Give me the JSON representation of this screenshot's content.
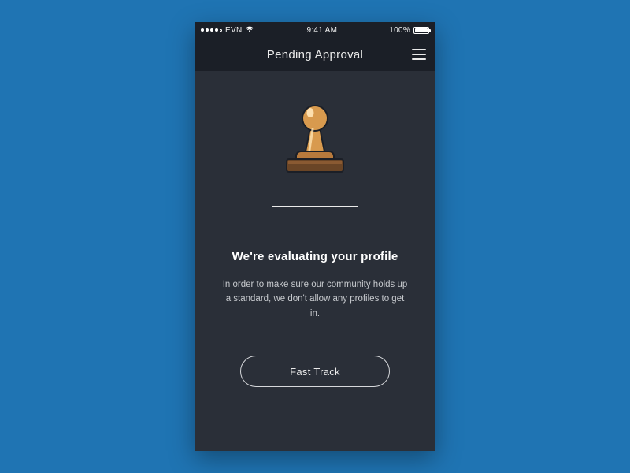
{
  "status_bar": {
    "carrier": "EVN",
    "time": "9:41 AM",
    "battery_pct": "100%"
  },
  "nav": {
    "title": "Pending Approval"
  },
  "content": {
    "headline": "We're evaluating your profile",
    "body": "In order to make sure our community holds up a standard, we don't allow any profiles to get in.",
    "cta_label": "Fast Track"
  }
}
